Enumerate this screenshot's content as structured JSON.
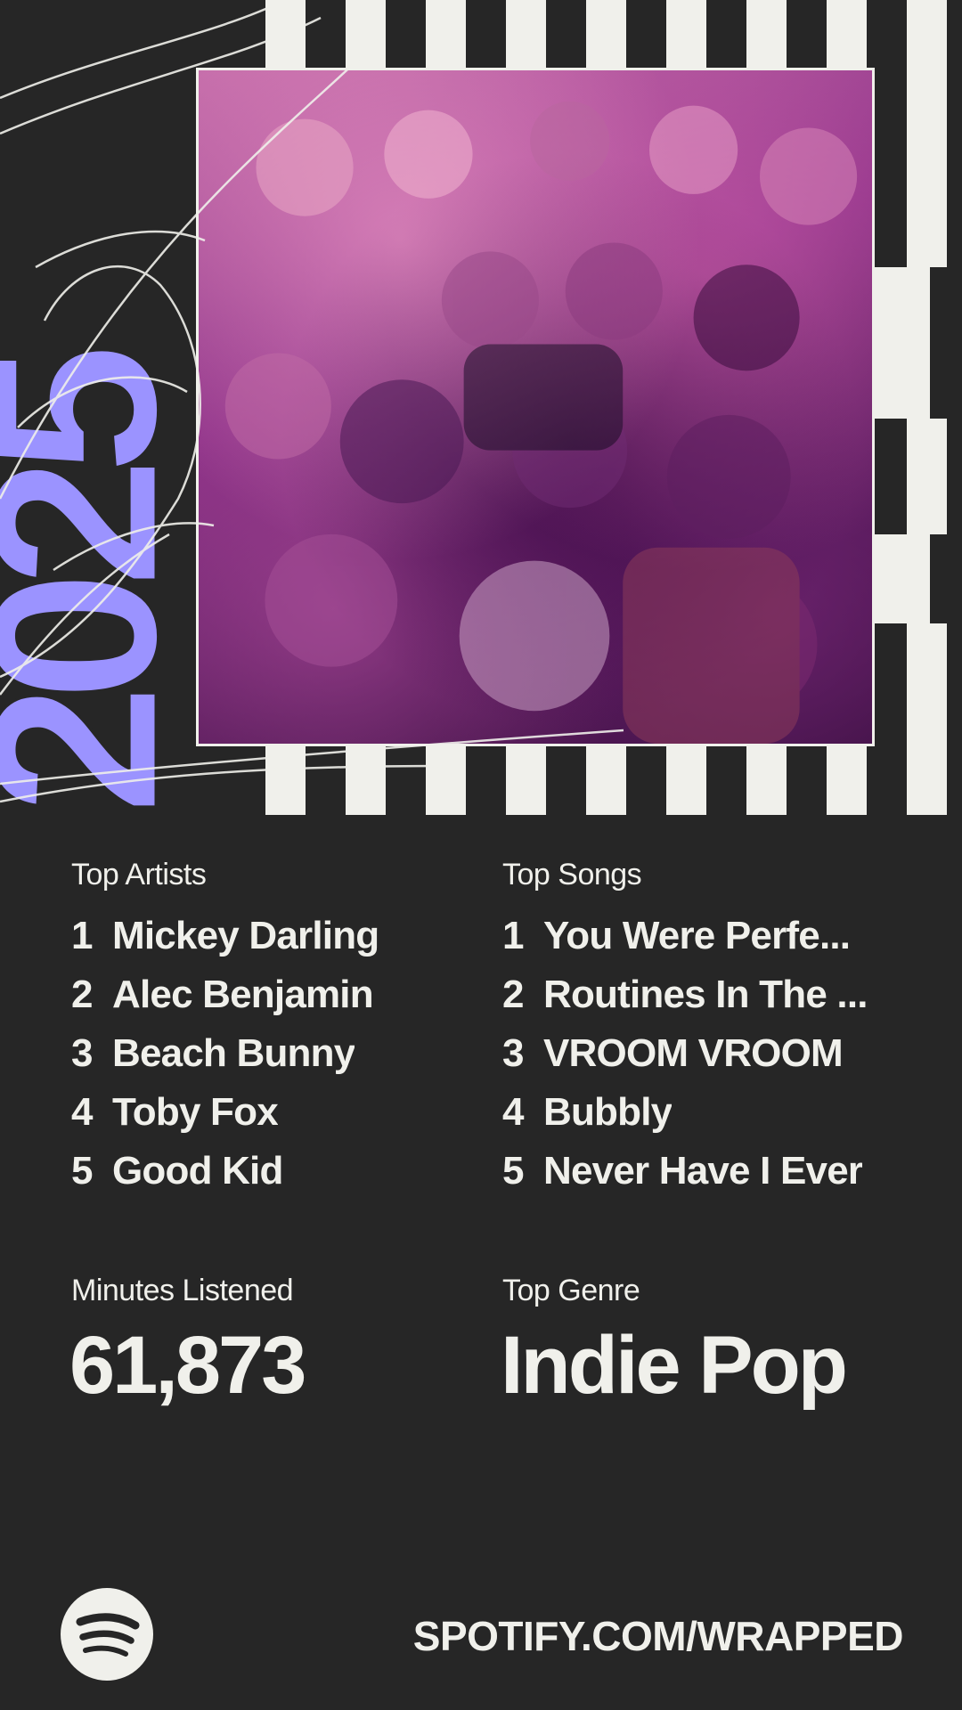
{
  "hero": {
    "year": "2025"
  },
  "colors": {
    "background": "#262626",
    "text": "#f0f0eb",
    "accent_year": "#9b93ff"
  },
  "top_artists": {
    "label": "Top Artists",
    "items": [
      {
        "rank": "1",
        "name": "Mickey Darling"
      },
      {
        "rank": "2",
        "name": "Alec Benjamin"
      },
      {
        "rank": "3",
        "name": "Beach Bunny"
      },
      {
        "rank": "4",
        "name": "Toby Fox"
      },
      {
        "rank": "5",
        "name": "Good Kid"
      }
    ]
  },
  "top_songs": {
    "label": "Top Songs",
    "items": [
      {
        "rank": "1",
        "name": "You Were Perfe..."
      },
      {
        "rank": "2",
        "name": "Routines In The ..."
      },
      {
        "rank": "3",
        "name": "VROOM VROOM"
      },
      {
        "rank": "4",
        "name": "Bubbly"
      },
      {
        "rank": "5",
        "name": "Never Have I Ever"
      }
    ]
  },
  "minutes": {
    "label": "Minutes Listened",
    "value": "61,873"
  },
  "genre": {
    "label": "Top Genre",
    "value": "Indie Pop"
  },
  "footer": {
    "logo_icon": "spotify-logo-icon",
    "url": "SPOTIFY.COM/WRAPPED"
  }
}
